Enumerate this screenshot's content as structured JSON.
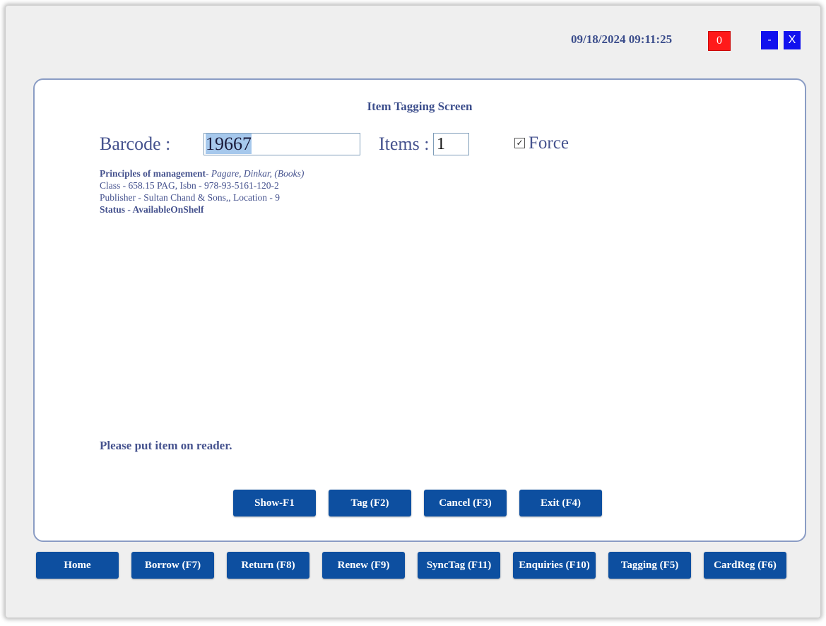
{
  "header": {
    "datetime": "09/18/2024 09:11:25",
    "counter": "0",
    "minimize_label": "-",
    "close_label": "X"
  },
  "screen": {
    "title": "Item Tagging Screen",
    "barcode_label": "Barcode :",
    "barcode_value": "19667",
    "items_label": "Items :",
    "items_value": "1",
    "force_label": "Force",
    "force_checked": true
  },
  "item": {
    "title": "Principles of management",
    "author_type": "- Pagare, Dinkar, (Books)",
    "class_isbn": "Class - 658.15 PAG, Isbn - 978-93-5161-120-2",
    "publisher_location": "Publisher - Sultan Chand & Sons,, Location - 9",
    "status": "Status - AvailableOnShelf"
  },
  "message": "Please put item on reader.",
  "actions": {
    "show": "Show-F1",
    "tag": "Tag (F2)",
    "cancel": "Cancel (F3)",
    "exit": "Exit (F4)"
  },
  "nav": {
    "home": "Home",
    "borrow": "Borrow (F7)",
    "return": "Return (F8)",
    "renew": "Renew (F9)",
    "synctag": "SyncTag (F11)",
    "enquiries": "Enquiries (F10)",
    "tagging": "Tagging (F5)",
    "cardreg": "CardReg (F6)"
  },
  "colors": {
    "accent_blue": "#0d4fa0",
    "counter_red": "#ff1a1a",
    "window_button_blue": "#1111ee",
    "text_navy": "#45528e"
  }
}
